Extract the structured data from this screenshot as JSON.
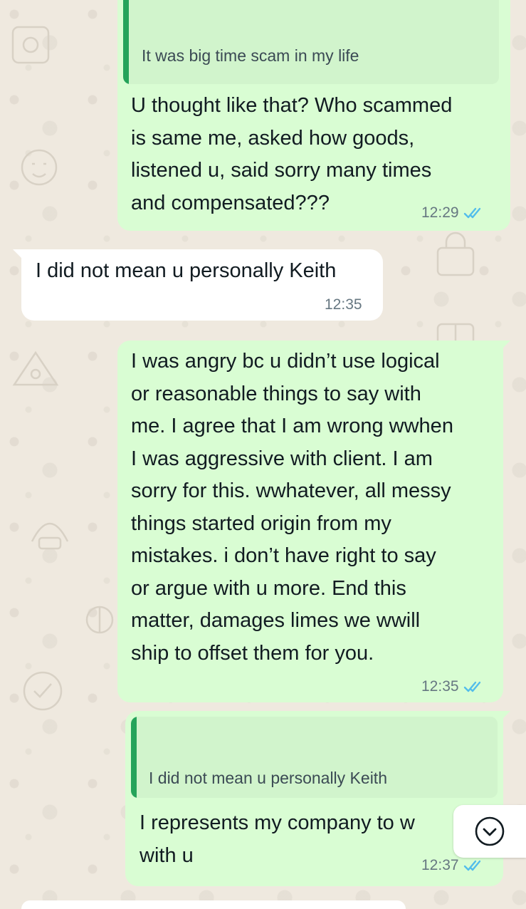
{
  "messages": [
    {
      "direction": "outgoing",
      "quote": "It was big time scam in my life",
      "text": "U thought like that? Who scammed\nis same me, asked how goods,\nlistened u, said sorry many times\nand compensated???",
      "time": "12:29",
      "status": "read"
    },
    {
      "direction": "incoming",
      "text": "I did not mean u personally Keith",
      "time": "12:35"
    },
    {
      "direction": "outgoing",
      "text": "I was angry bc u didn’t use logical\nor reasonable things to say with\nme. I agree that I am wrong wwhen\nI was aggressive with client. I am\nsorry for this. wwhatever, all messy\nthings started origin from my\nmistakes. i don’t have right to say\nor argue with u more. End this\nmatter, damages limes we wwill\nship to offset them for you.",
      "time": "12:35",
      "status": "read"
    },
    {
      "direction": "outgoing",
      "quote": "I did not mean u personally Keith",
      "text": "I represents my company to  w\nwith u",
      "time": "12:37",
      "status": "read"
    }
  ],
  "scroll_button": {
    "icon": "chevron-down-circle-icon"
  },
  "colors": {
    "outgoing_bubble": "#d9fdd3",
    "incoming_bubble": "#ffffff",
    "quote_bar": "#25a35a",
    "read_ticks": "#53bdeb",
    "wallpaper": "#efeae2"
  }
}
